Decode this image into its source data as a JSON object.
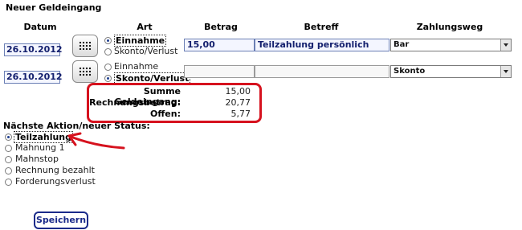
{
  "title": "Neuer Geldeingang",
  "columns": {
    "datum": "Datum",
    "art": "Art",
    "betrag": "Betrag",
    "betreff": "Betreff",
    "zahlungsweg": "Zahlungsweg"
  },
  "rows": [
    {
      "date": "26.10.2012",
      "option_1": "Einnahme",
      "option_2": "Skonto/Verlust",
      "selected": "Einnahme",
      "betrag": "15,00",
      "betreff": "Teilzahlung persönlich",
      "zahlungsweg": "Bar"
    },
    {
      "date": "26.10.2012",
      "option_1": "Einnahme",
      "option_2": "Skonto/Verlust",
      "selected": "Skonto/Verlust",
      "betrag": "",
      "betreff": "",
      "zahlungsweg": "Skonto"
    }
  ],
  "summary": {
    "summe_label": "Summe Geldeingang:",
    "summe_value": "15,00",
    "rechnung_label": "Rechnungsbetrag:",
    "rechnung_value": "20,77",
    "offen_label": "Offen:",
    "offen_value": "5,77"
  },
  "status": {
    "heading": "Nächste Aktion/neuer Status:",
    "selected": "Teilzahlung",
    "options": [
      "Teilzahlung",
      "Mahnung 1",
      "Mahnstop",
      "Rechnung bezahlt",
      "Forderungsverlust"
    ]
  },
  "save_label": "Speichern",
  "colors": {
    "highlight": "#d6121e",
    "field_text": "#14206e",
    "button_border": "#1a2a8a"
  },
  "icons": {
    "calendar": "calendar-icon",
    "dropdown": "chevron-down-icon",
    "annotation": "red-arrow"
  }
}
